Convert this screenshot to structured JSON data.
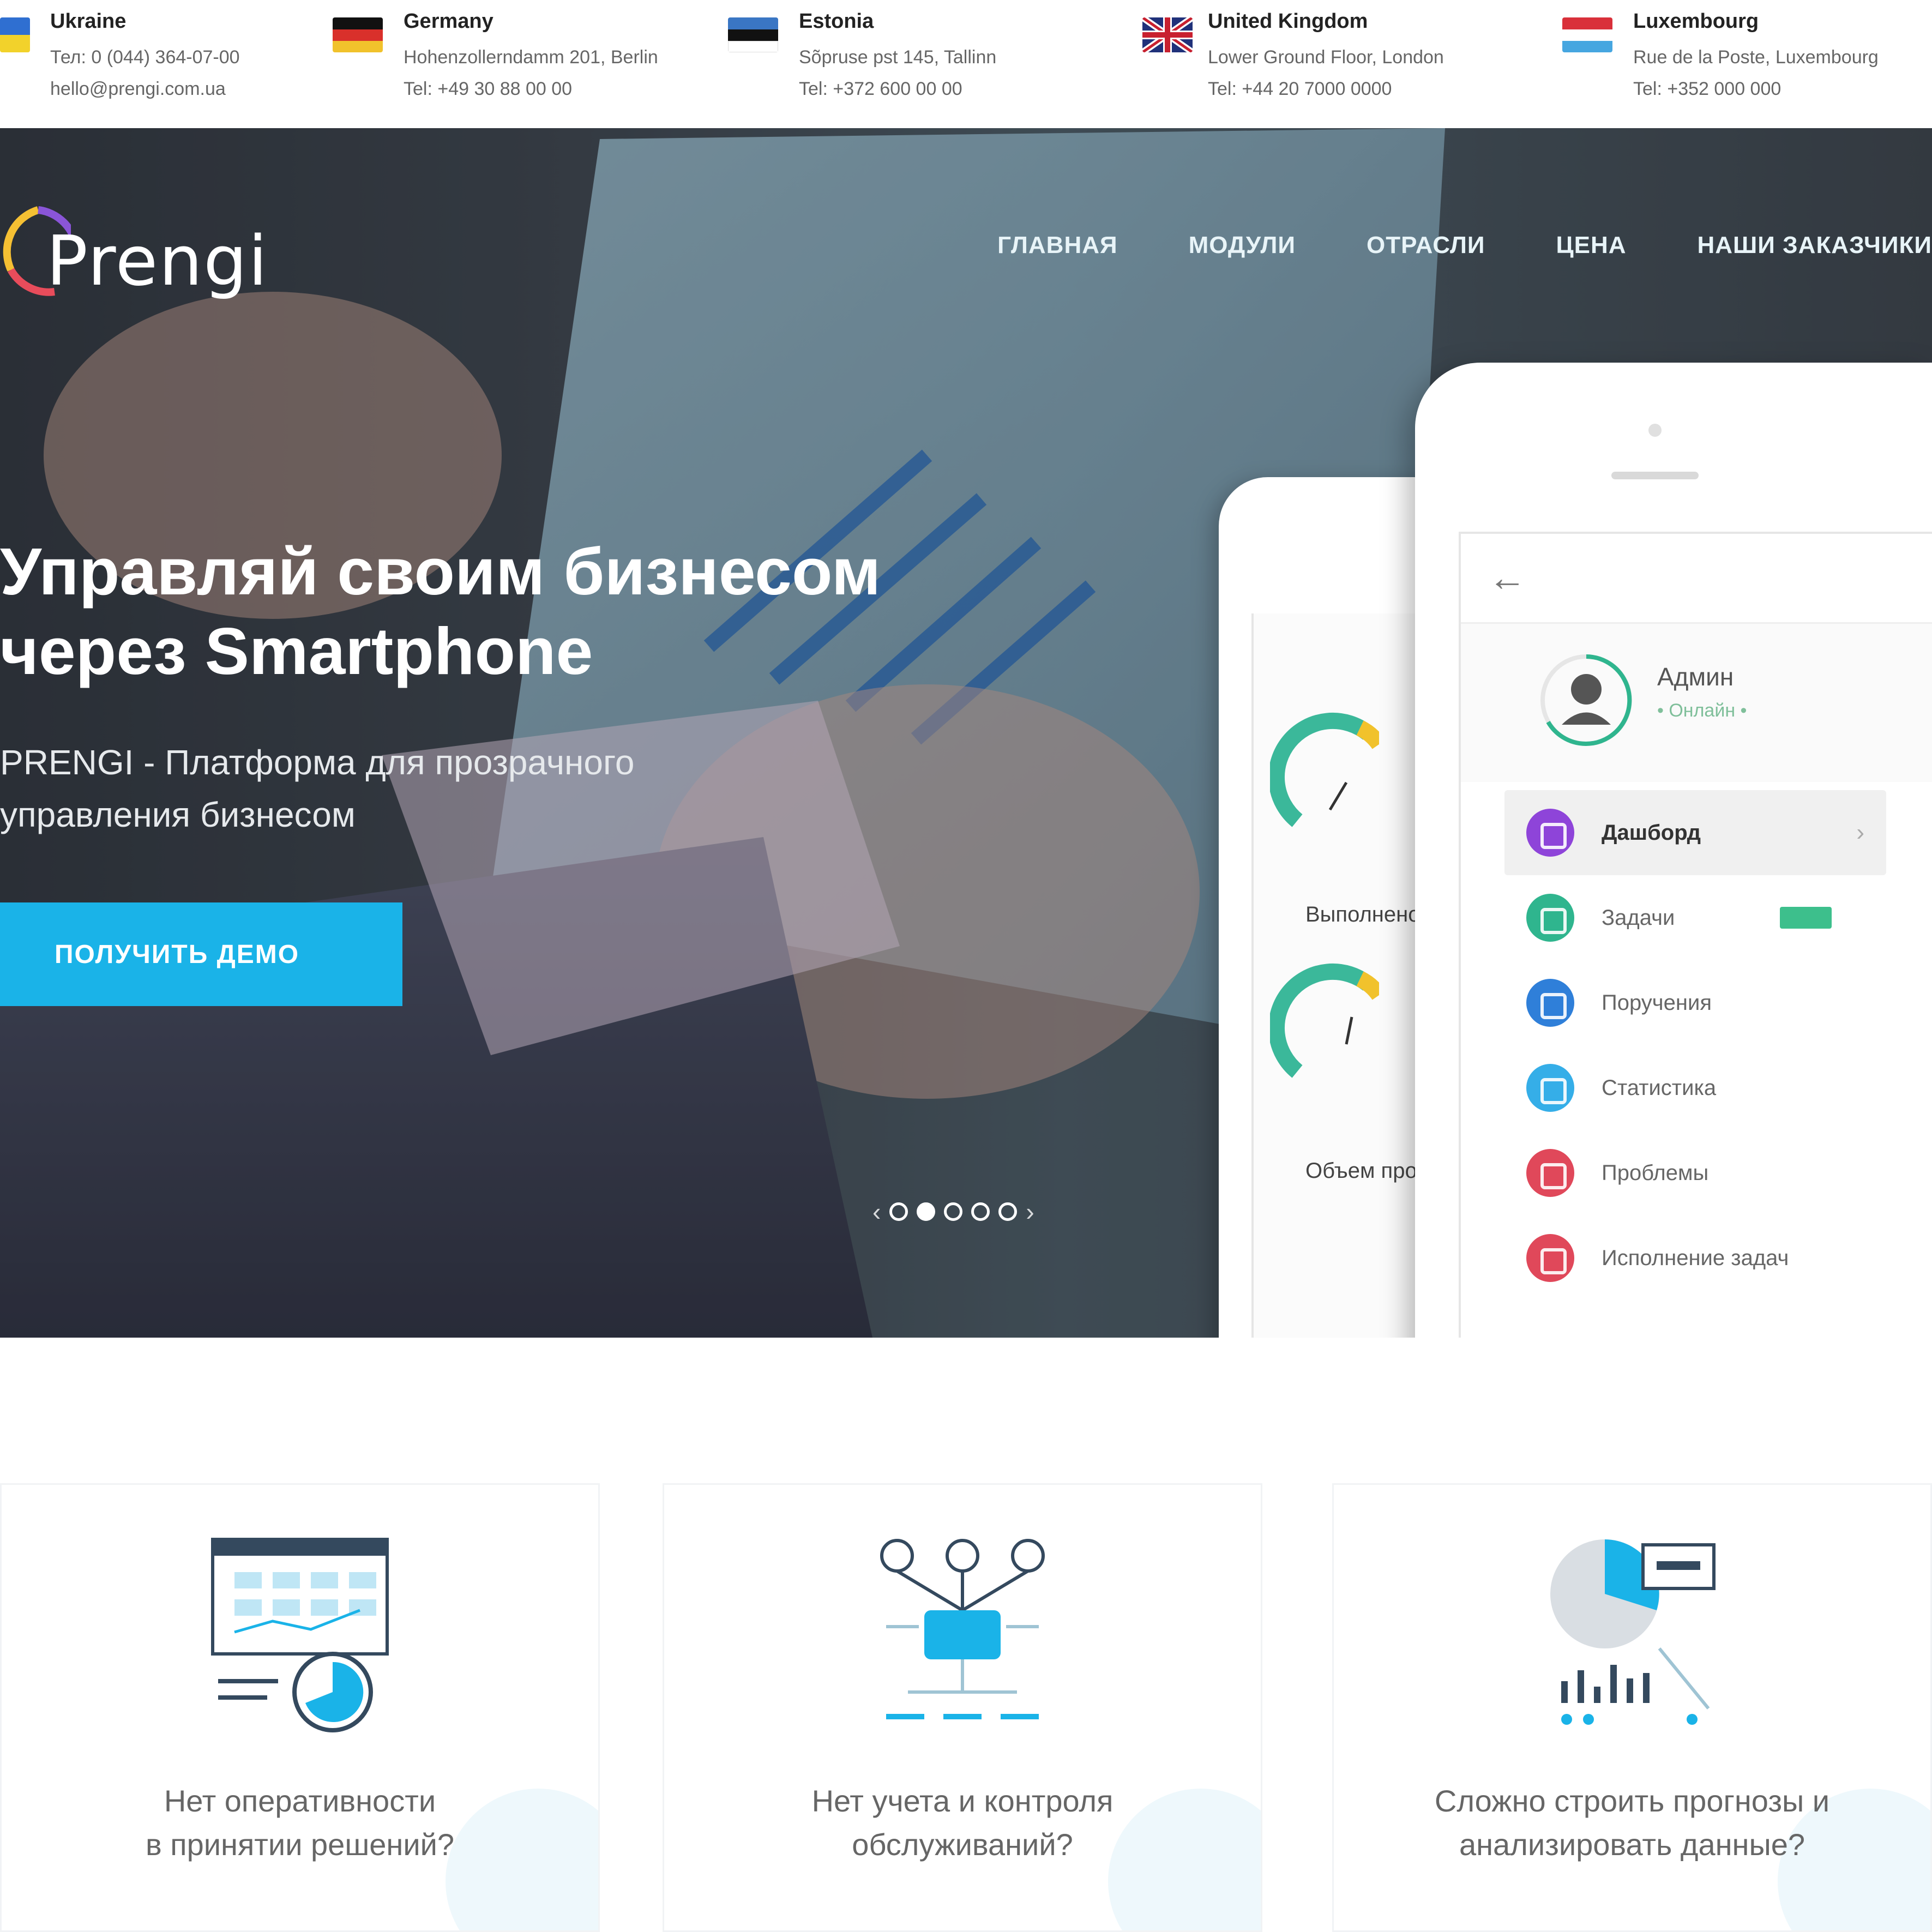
{
  "topbar": {
    "offices": [
      {
        "flag": "ukraine",
        "country": "Ukraine",
        "line1": "Тел: 0 (044) 364-07-00",
        "line2": "hello@prengi.com.ua"
      },
      {
        "flag": "germany",
        "country": "Germany",
        "line1": "Hohenzollerndamm 201, Berlin",
        "line2": "Tel: +49 30 88 00 00"
      },
      {
        "flag": "estonia",
        "country": "Estonia",
        "line1": "Sõpruse pst 145, Tallinn",
        "line2": "Tel: +372 600 00 00"
      },
      {
        "flag": "uk",
        "country": "United Kingdom",
        "line1": "Lower Ground Floor, London",
        "line2": "Tel: +44 20 7000 0000"
      },
      {
        "flag": "netherlands",
        "country": "Luxembourg",
        "line1": "Rue de la Poste, Luxembourg",
        "line2": "Tel: +352 000 000"
      }
    ]
  },
  "brand": {
    "logo_text": "Prengi"
  },
  "nav": {
    "items": [
      "ГЛАВНАЯ",
      "МОДУЛИ",
      "ОТРАСЛИ",
      "ЦЕНА",
      "НАШИ ЗАКАЗЧИКИ"
    ]
  },
  "hero": {
    "headline_line1": "Управляй своим бизнесом",
    "headline_line2": "через Smartphone",
    "sub_line1": "PRENGI - Платформа для прозрачного",
    "sub_line2": "управления бизнесом",
    "cta_label": "ПОЛУЧИТЬ ДЕМО"
  },
  "slider": {
    "count": 5,
    "active_index": 1
  },
  "phone_back": {
    "gauge1_label": "Выполнено",
    "gauge2_label": "Объем продаж"
  },
  "phone_front": {
    "profile_name": "Админ",
    "profile_status": "• Онлайн •",
    "menu": [
      {
        "label": "Дашборд",
        "color": "#8e44d9",
        "active": true
      },
      {
        "label": "Задачи",
        "color": "#2fb58e",
        "badge": true
      },
      {
        "label": "Поручения",
        "color": "#2f7fd9"
      },
      {
        "label": "Статистика",
        "color": "#35aee8"
      },
      {
        "label": "Проблемы",
        "color": "#e0485a"
      },
      {
        "label": "Исполнение задач",
        "color": "#e0485a"
      }
    ]
  },
  "features": [
    {
      "title_line1": "Нет оперативности",
      "title_line2": "в принятии решений?"
    },
    {
      "title_line1": "Нет учета и контроля",
      "title_line2": "обслуживаний?"
    },
    {
      "title_line1": "Сложно строить прогнозы и",
      "title_line2": "анализировать данные?"
    }
  ],
  "colors": {
    "accent": "#1ab3e8",
    "hero_dark": "#2f343b",
    "green": "#2fb58e",
    "purple": "#8e44d9"
  }
}
